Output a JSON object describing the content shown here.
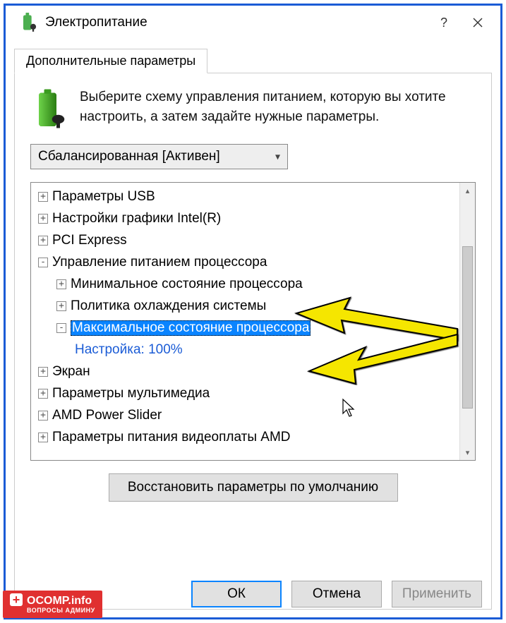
{
  "window": {
    "title": "Электропитание"
  },
  "tabs": {
    "additional": "Дополнительные параметры"
  },
  "intro": "Выберите схему управления питанием, которую вы хотите настроить, а затем задайте нужные параметры.",
  "plan": {
    "selected": "Сбалансированная [Активен]"
  },
  "tree": {
    "n0": "Параметры USB",
    "n1": "Настройки графики Intel(R)",
    "n2": "PCI Express",
    "n3": "Управление питанием процессора",
    "n3a": "Минимальное состояние процессора",
    "n3b": "Политика охлаждения системы",
    "n3c": "Максимальное состояние процессора",
    "n3c_set": "Настройка: 100%",
    "n4": "Экран",
    "n5": "Параметры мультимедиа",
    "n6": "AMD Power Slider",
    "n7": "Параметры питания видеоплаты AMD"
  },
  "buttons": {
    "restore": "Восстановить параметры по умолчанию",
    "ok": "ОК",
    "cancel": "Отмена",
    "apply": "Применить"
  },
  "watermark": {
    "brand": "OCOMP.info",
    "sub": "ВОПРОСЫ АДМИНУ"
  }
}
